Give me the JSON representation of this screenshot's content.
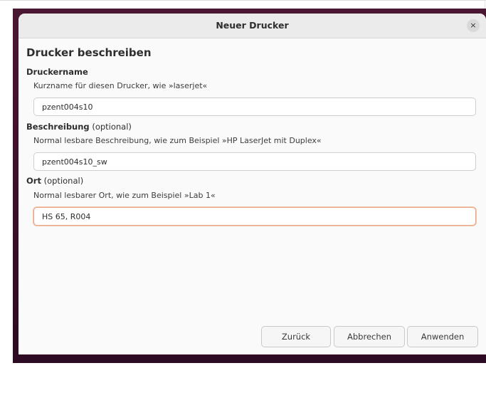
{
  "dialog": {
    "title": "Neuer Drucker",
    "close_symbol": "×",
    "heading": "Drucker beschreiben"
  },
  "fields": {
    "name": {
      "label": "Druckername",
      "hint": "Kurzname für diesen Drucker, wie »laserjet«",
      "value": "pzent004s10"
    },
    "description": {
      "label": "Beschreibung",
      "label_suffix": " (optional)",
      "hint": "Normal lesbare Beschreibung, wie zum Beispiel »HP LaserJet mit Duplex«",
      "value": "pzent004s10_sw"
    },
    "location": {
      "label": "Ort",
      "label_suffix": " (optional)",
      "hint": "Normal lesbarer Ort, wie zum Beispiel »Lab 1«",
      "value": "HS 65, R004"
    }
  },
  "buttons": {
    "back": "Zurück",
    "cancel": "Abbrechen",
    "apply": "Anwenden"
  }
}
